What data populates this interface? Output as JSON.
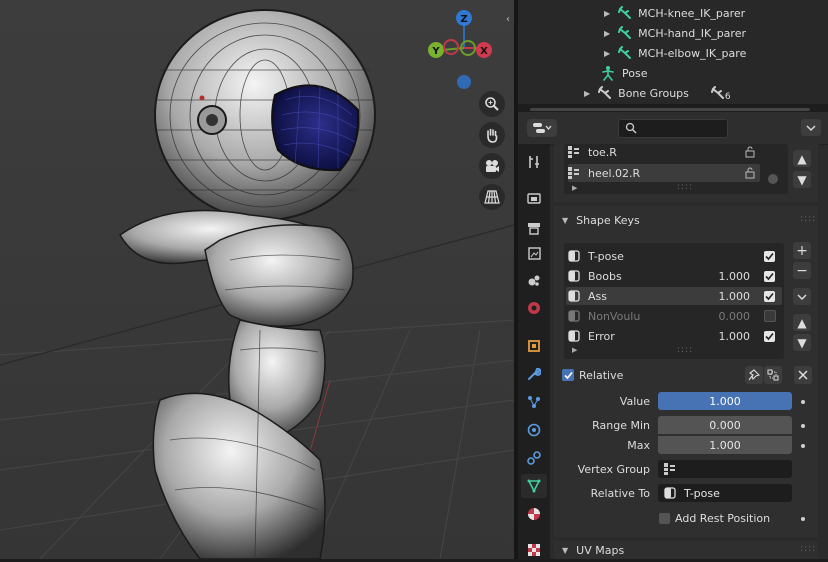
{
  "outliner": {
    "items": [
      {
        "label": "MCH-knee_IK_parer",
        "type": "bone"
      },
      {
        "label": "MCH-hand_IK_parer",
        "type": "bone"
      },
      {
        "label": "MCH-elbow_IK_pare",
        "type": "bone"
      },
      {
        "label": "Pose",
        "type": "pose"
      },
      {
        "label": "Bone Groups",
        "type": "bone-groups",
        "count": "6"
      }
    ]
  },
  "vertex_groups": {
    "items": [
      {
        "label": "toe.R",
        "selected": false
      },
      {
        "label": "heel.02.R",
        "selected": true
      }
    ]
  },
  "shape_keys": {
    "title": "Shape Keys",
    "items": [
      {
        "label": "T-pose",
        "value": "",
        "checked": true,
        "enabled": true
      },
      {
        "label": "Boobs",
        "value": "1.000",
        "checked": true,
        "enabled": true
      },
      {
        "label": "Ass",
        "value": "1.000",
        "checked": true,
        "enabled": true,
        "selected": true
      },
      {
        "label": "NonVoulu",
        "value": "0.000",
        "checked": false,
        "enabled": false
      },
      {
        "label": "Error",
        "value": "1.000",
        "checked": true,
        "enabled": true
      }
    ],
    "relative_label": "Relative",
    "fields": {
      "value_label": "Value",
      "value": "1.000",
      "range_min_label": "Range Min",
      "range_min": "0.000",
      "max_label": "Max",
      "max": "1.000",
      "vertex_group_label": "Vertex Group",
      "vertex_group": "",
      "relative_to_label": "Relative To",
      "relative_to": "T-pose",
      "add_rest_label": "Add Rest Position"
    }
  },
  "uv_maps": {
    "title": "UV Maps"
  },
  "colors": {
    "accent": "#4772b3",
    "bone": "#3fcf9f",
    "panel": "#2b2b2b",
    "viewport": "#3b3b3b"
  }
}
